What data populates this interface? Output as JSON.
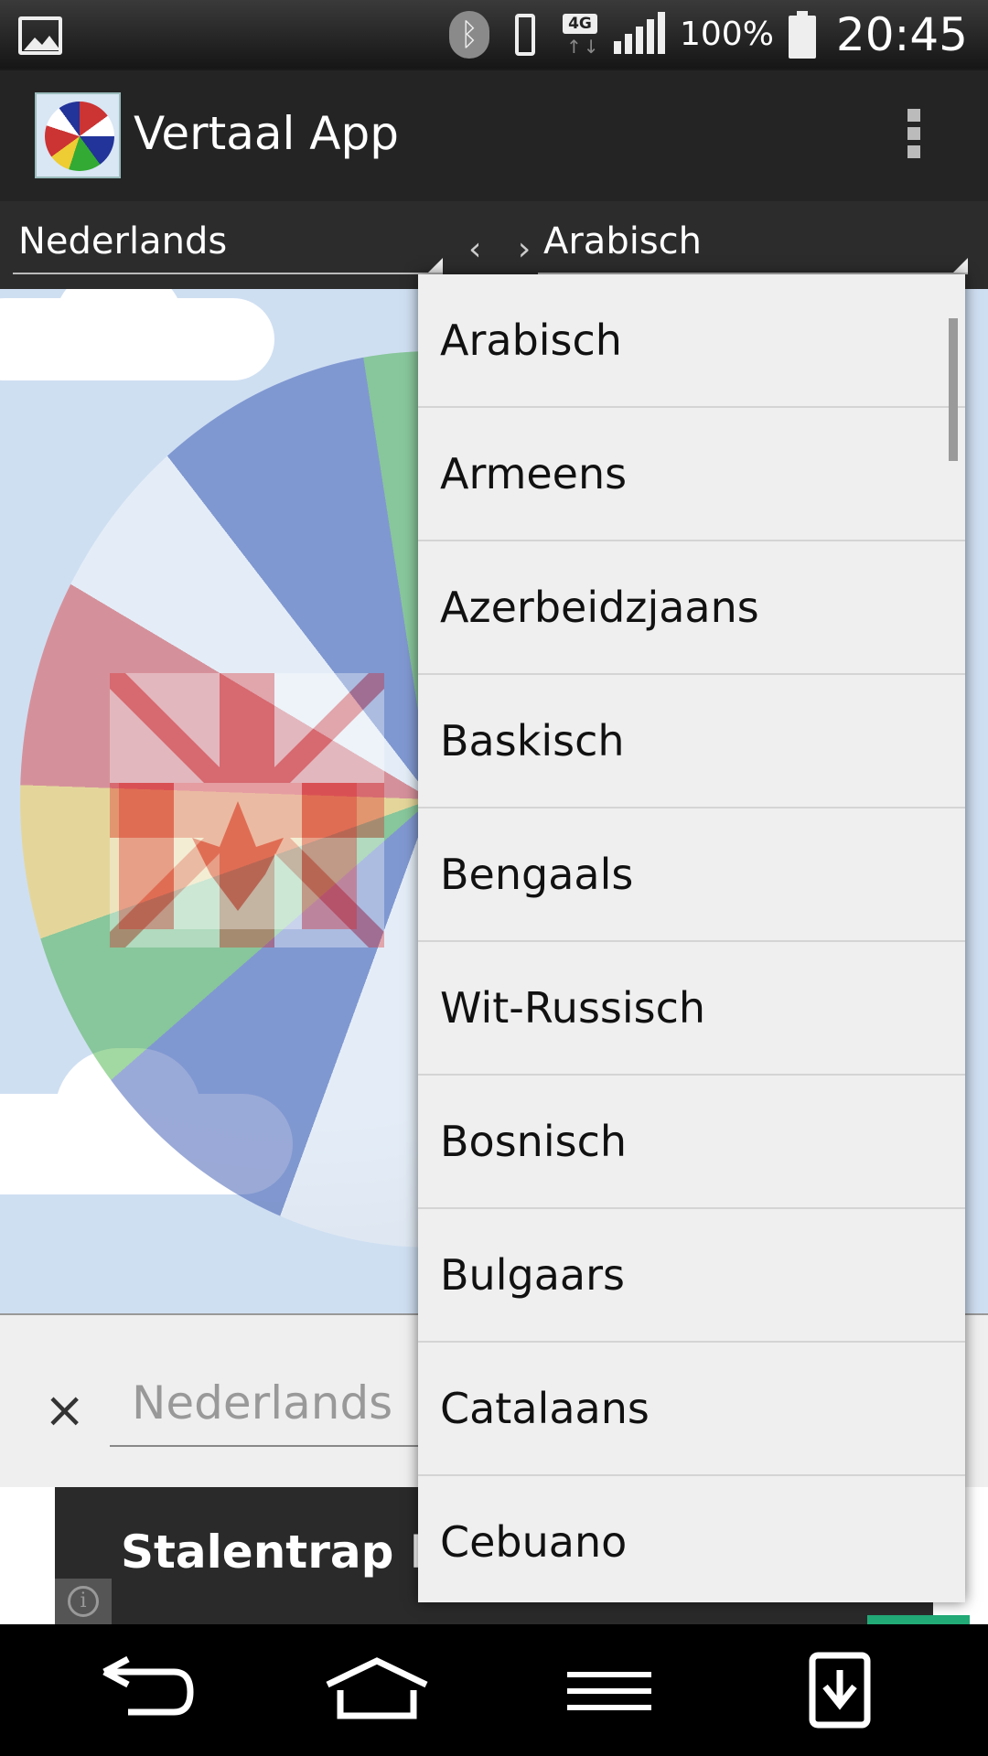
{
  "status_bar": {
    "battery_pct": "100%",
    "time": "20:45",
    "network": "4G",
    "icons": [
      "gallery-icon",
      "bluetooth-icon",
      "vibrate-icon",
      "network-4g-icon",
      "signal-icon",
      "battery-icon"
    ]
  },
  "action_bar": {
    "title": "Vertaal App",
    "app_icon": "globe-flags-icon",
    "menu_icon": "overflow-menu-icon"
  },
  "language_bar": {
    "source_language": "Nederlands",
    "swap_label": "‹ ›",
    "target_language": "Arabisch"
  },
  "input": {
    "clear_label": "×",
    "placeholder": "Nederlands"
  },
  "ad": {
    "title": "Stalentrap Re",
    "info_icon": "i"
  },
  "dropdown": {
    "items": [
      {
        "label": "Arabisch"
      },
      {
        "label": "Armeens"
      },
      {
        "label": "Azerbeidzjaans"
      },
      {
        "label": "Baskisch"
      },
      {
        "label": "Bengaals"
      },
      {
        "label": "Wit-Russisch"
      },
      {
        "label": "Bosnisch"
      },
      {
        "label": "Bulgaars"
      },
      {
        "label": "Catalaans"
      },
      {
        "label": "Cebuano"
      }
    ]
  },
  "nav_bar": {
    "icons": [
      "back-icon",
      "home-icon",
      "menu-icon",
      "download-icon"
    ]
  },
  "colors": {
    "status_bar": "#161616",
    "action_bar": "#242424",
    "language_bar": "#2c2c2c",
    "dropdown_bg": "#efefef",
    "background_sky": "#cfdff2"
  }
}
